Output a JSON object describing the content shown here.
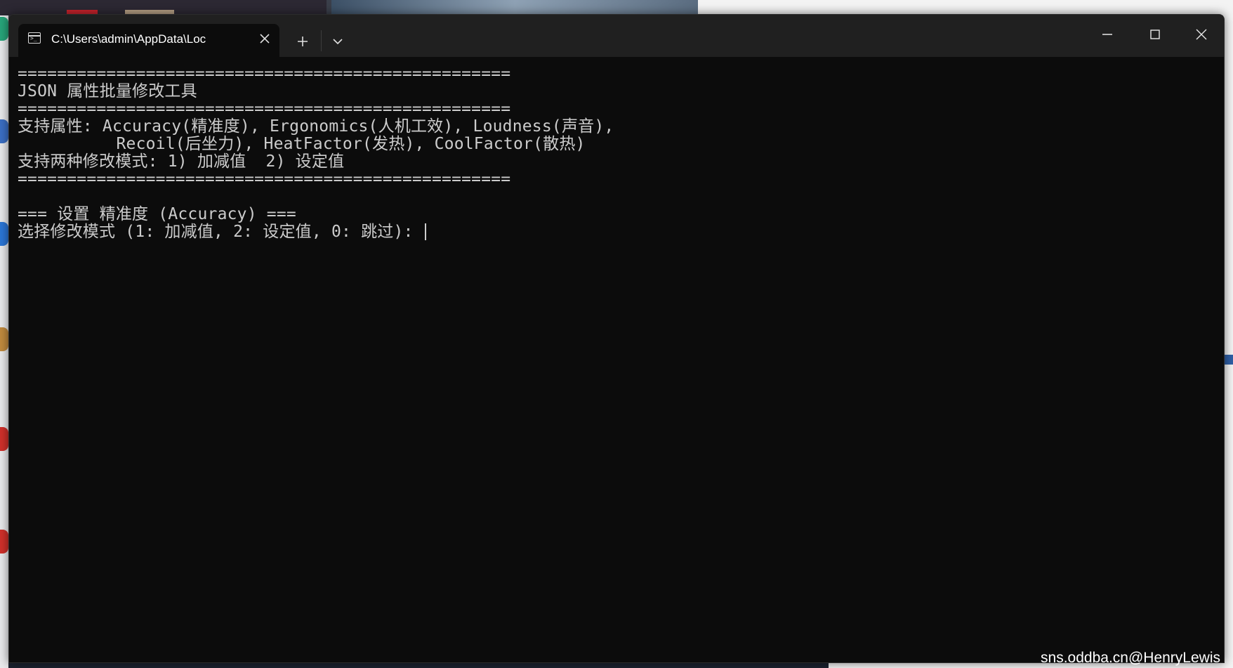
{
  "window": {
    "tab_title": "C:\\Users\\admin\\AppData\\Loc",
    "tab_icon": "terminal-icon"
  },
  "terminal": {
    "lines": [
      "==================================================",
      "JSON 属性批量修改工具",
      "==================================================",
      "支持属性: Accuracy(精准度), Ergonomics(人机工效), Loudness(声音),",
      "          Recoil(后坐力), HeatFactor(发热), CoolFactor(散热)",
      "支持两种修改模式: 1) 加减值  2) 设定值",
      "==================================================",
      "",
      "=== 设置 精准度 (Accuracy) ===",
      "选择修改模式 (1: 加减值, 2: 设定值, 0: 跳过): "
    ]
  },
  "watermark": "sns.oddba.cn@HenryLewis",
  "colors": {
    "terminal_bg": "#0c0c0c",
    "titlebar_bg": "#202020",
    "text": "#cccccc"
  }
}
